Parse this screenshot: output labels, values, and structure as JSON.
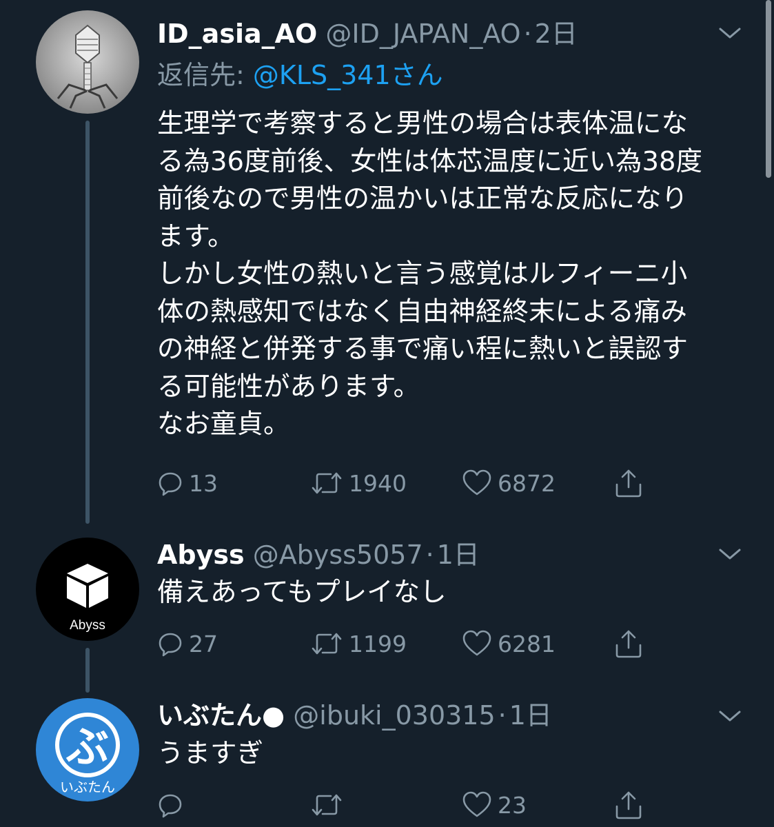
{
  "tweets": [
    {
      "display_name": "ID_asia_AO",
      "handle": "@ID_JAPAN_AO",
      "time": "2日",
      "reply_prefix": "返信先:",
      "reply_to": "@KLS_341さん",
      "text": "生理学で考察すると男性の場合は表体温にな\nる為36度前後、女性は体芯温度に近い為38度\n前後なので男性の温かいは正常な反応になり\nます。\nしかし女性の熱いと言う感覚はルフィーニ小\n体の熱感知ではなく自由神経終末による痛み\nの神経と併発する事で痛い程に熱いと誤認す\nる可能性があります。\nなお童貞。",
      "replies": "13",
      "retweets": "1940",
      "likes": "6872"
    },
    {
      "display_name": "Abyss",
      "handle": "@Abyss5057",
      "time": "1日",
      "avatar_text": "Abyss",
      "text": "備えあってもプレイなし",
      "replies": "27",
      "retweets": "1199",
      "likes": "6281"
    },
    {
      "display_name": "いぶたん●",
      "handle": "@ibuki_030315",
      "time": "1日",
      "avatar_glyph": "ぶ",
      "avatar_text": "いぶたん",
      "text": "うますぎ",
      "replies": "",
      "retweets": "",
      "likes": "23"
    }
  ],
  "separator": "·",
  "icons": [
    "reply-icon",
    "retweet-icon",
    "like-icon",
    "share-icon",
    "chevron-down-icon"
  ],
  "colors": {
    "background": "#15202b",
    "secondary_text": "#8899a6",
    "link": "#1da1f2",
    "thread_line": "#3d5466"
  }
}
